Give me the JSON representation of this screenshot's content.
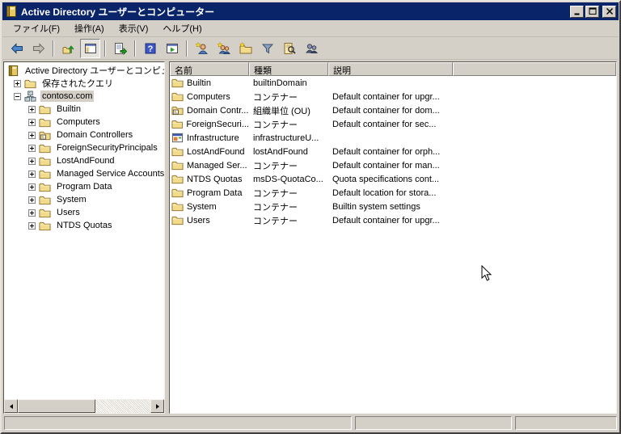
{
  "window": {
    "title": "Active Directory ユーザーとコンピューター"
  },
  "menu": {
    "items": [
      "ファイル(F)",
      "操作(A)",
      "表示(V)",
      "ヘルプ(H)"
    ]
  },
  "toolbar": {
    "icons": [
      "back",
      "forward",
      "up-one-level",
      "show-hide-console-tree",
      "export-list",
      "help",
      "show-action-pane",
      "new-user",
      "new-group",
      "new-organizational-unit",
      "set-filter",
      "find-objects",
      "add-to-group"
    ],
    "pressed": "show-hide-console-tree"
  },
  "tree": {
    "root": {
      "label": "Active Directory ユーザーとコンピューター",
      "icon": "console-root-icon"
    },
    "items": [
      {
        "label": "保存されたクエリ",
        "icon": "folder-icon",
        "expand": "+",
        "level": 1
      },
      {
        "label": "contoso.com",
        "icon": "domain-icon",
        "expand": "-",
        "level": 1,
        "selected": true
      },
      {
        "label": "Builtin",
        "icon": "folder-icon",
        "expand": "+",
        "level": 2
      },
      {
        "label": "Computers",
        "icon": "folder-icon",
        "expand": "+",
        "level": 2
      },
      {
        "label": "Domain Controllers",
        "icon": "ou-folder-icon",
        "expand": "+",
        "level": 2
      },
      {
        "label": "ForeignSecurityPrincipals",
        "icon": "folder-icon",
        "expand": "+",
        "level": 2
      },
      {
        "label": "LostAndFound",
        "icon": "folder-icon",
        "expand": "+",
        "level": 2
      },
      {
        "label": "Managed Service Accounts",
        "icon": "folder-icon",
        "expand": "+",
        "level": 2
      },
      {
        "label": "Program Data",
        "icon": "folder-icon",
        "expand": "+",
        "level": 2
      },
      {
        "label": "System",
        "icon": "folder-icon",
        "expand": "+",
        "level": 2
      },
      {
        "label": "Users",
        "icon": "folder-icon",
        "expand": "+",
        "level": 2
      },
      {
        "label": "NTDS Quotas",
        "icon": "folder-icon",
        "expand": "+",
        "level": 2
      }
    ]
  },
  "list": {
    "columns": [
      "名前",
      "種類",
      "説明"
    ],
    "rows": [
      {
        "icon": "folder-icon",
        "name": "Builtin",
        "type": "builtinDomain",
        "description": ""
      },
      {
        "icon": "folder-icon",
        "name": "Computers",
        "type": "コンテナー",
        "description": "Default container for upgr..."
      },
      {
        "icon": "ou-folder-icon",
        "name": "Domain Contr...",
        "type": "組織単位 (OU)",
        "description": "Default container for dom..."
      },
      {
        "icon": "folder-icon",
        "name": "ForeignSecuri...",
        "type": "コンテナー",
        "description": "Default container for sec..."
      },
      {
        "icon": "infrastructure-icon",
        "name": "Infrastructure",
        "type": "infrastructureU...",
        "description": ""
      },
      {
        "icon": "folder-icon",
        "name": "LostAndFound",
        "type": "lostAndFound",
        "description": "Default container for orph..."
      },
      {
        "icon": "folder-icon",
        "name": "Managed Ser...",
        "type": "コンテナー",
        "description": "Default container for man..."
      },
      {
        "icon": "folder-icon",
        "name": "NTDS Quotas",
        "type": "msDS-QuotaCo...",
        "description": "Quota specifications cont..."
      },
      {
        "icon": "folder-icon",
        "name": "Program Data",
        "type": "コンテナー",
        "description": "Default location for stora..."
      },
      {
        "icon": "folder-icon",
        "name": "System",
        "type": "コンテナー",
        "description": "Builtin system settings"
      },
      {
        "icon": "folder-icon",
        "name": "Users",
        "type": "コンテナー",
        "description": "Default container for upgr..."
      }
    ]
  },
  "status_bar": {
    "panels": [
      "",
      "",
      ""
    ]
  },
  "colors": {
    "titlebar": "#0a246a",
    "chrome": "#d4d0c8",
    "pane_bg": "#ffffff",
    "selection_inactive": "#d4d0c8",
    "folder": "#f2dc8c"
  }
}
